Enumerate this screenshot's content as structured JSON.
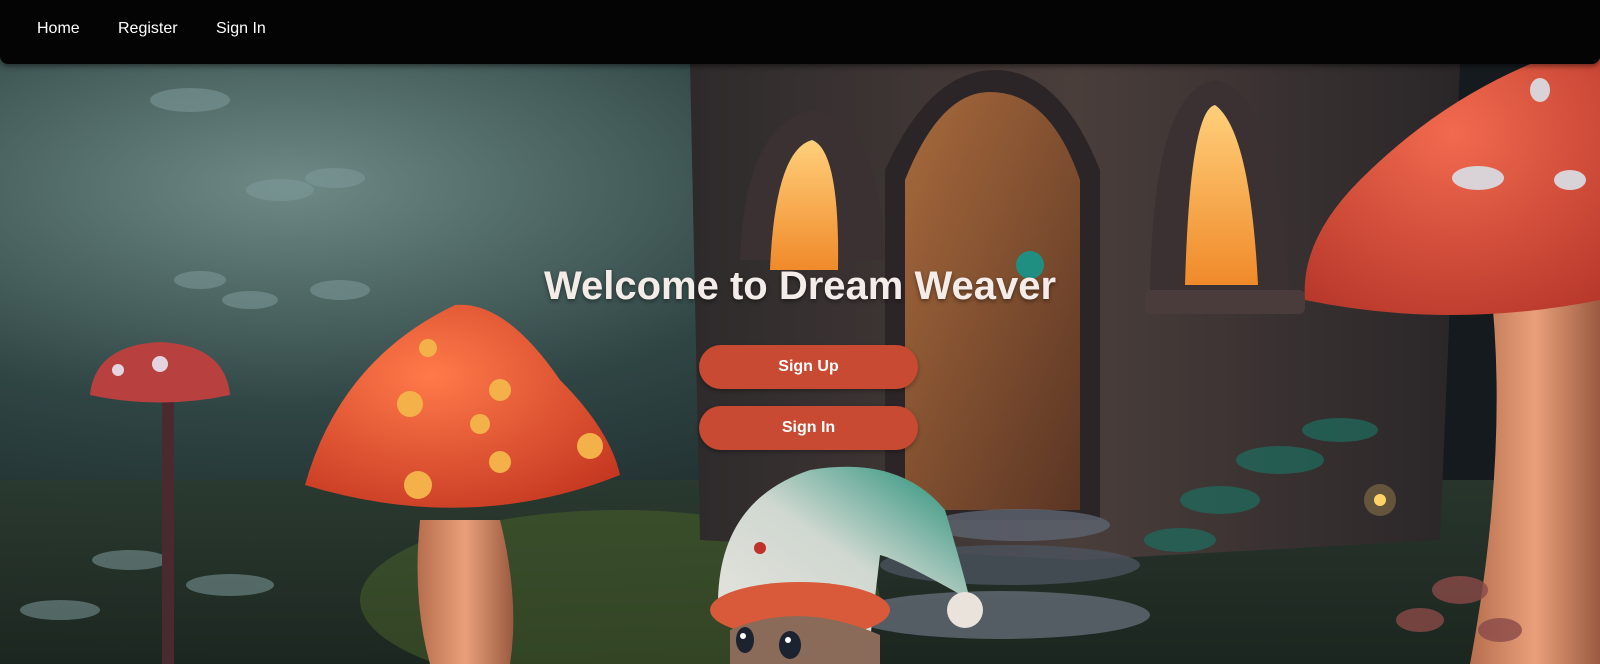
{
  "nav": {
    "home": "Home",
    "register": "Register",
    "signin": "Sign In"
  },
  "hero": {
    "title": "Welcome to Dream Weaver",
    "signup_button": "Sign Up",
    "signin_button": "Sign In"
  },
  "colors": {
    "navbar": "#040404",
    "button": "#c94a33",
    "button_text": "#ffffff",
    "title": "#f3ece9"
  }
}
